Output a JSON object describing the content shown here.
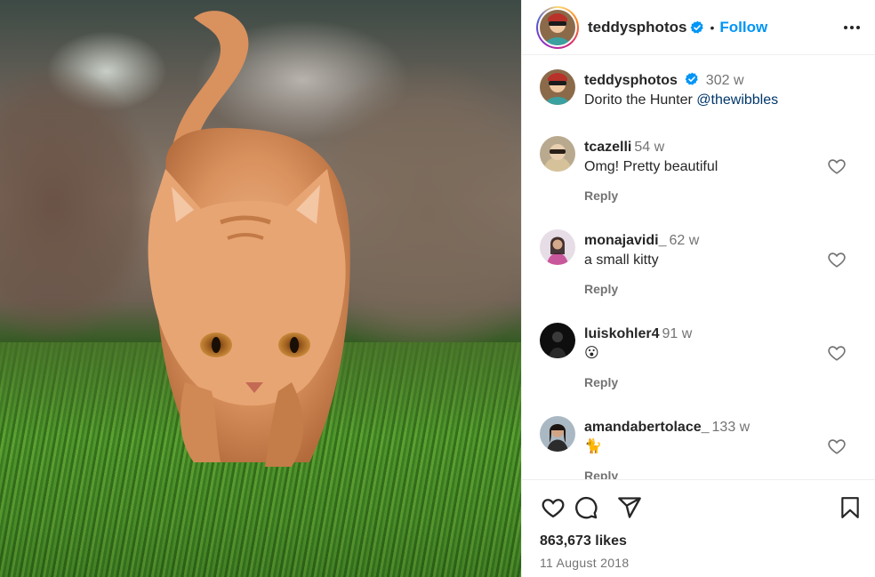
{
  "post": {
    "author": "teddysphotos",
    "follow_label": "Follow",
    "separator": "•",
    "image_icon": "photo-of-orange-cat",
    "likes": "863,673 likes",
    "date": "11 August 2018"
  },
  "caption": {
    "username": "teddysphotos",
    "age": "302 w",
    "text": "Dorito the Hunter ",
    "mention": "@thewibbles"
  },
  "comments": [
    {
      "username": "tcazelli",
      "age": "54 w",
      "text": "Omg! Pretty beautiful",
      "reply": "Reply"
    },
    {
      "username": "monajavidi_",
      "age": "62 w",
      "text": "a small kitty",
      "reply": "Reply"
    },
    {
      "username": "luiskohler4",
      "age": "91 w",
      "text": "😮",
      "reply": "Reply"
    },
    {
      "username": "amandabertolace_",
      "age": "133 w",
      "text": "🐈",
      "reply": "Reply"
    }
  ],
  "actions": [
    "heart-icon",
    "comment-icon",
    "share-icon",
    "bookmark-icon"
  ],
  "colors": {
    "accent": "#0095f6",
    "verified": "#0095f6",
    "text": "#262626",
    "muted": "#737373"
  }
}
